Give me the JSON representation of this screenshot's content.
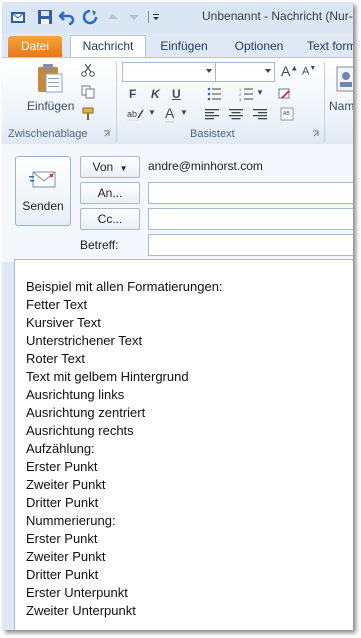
{
  "window": {
    "title": "Unbenannt - Nachricht (Nur-Text)"
  },
  "tabs": [
    {
      "label": "Datei"
    },
    {
      "label": "Nachricht"
    },
    {
      "label": "Einfügen"
    },
    {
      "label": "Optionen"
    },
    {
      "label": "Text formatieren"
    }
  ],
  "ribbon": {
    "paste_label": "Einfügen",
    "group_clipboard": "Zwischenablage",
    "group_basictext": "Basistext",
    "names_label": "Namen",
    "bold": "F",
    "italic": "K",
    "underline": "U"
  },
  "header": {
    "send_label": "Senden",
    "from_label": "Von",
    "from_value": "andre@minhorst.com",
    "to_label": "An...",
    "cc_label": "Cc...",
    "subject_label": "Betreff:"
  },
  "body": {
    "lines": [
      "Beispiel mit allen Formatierungen:",
      "Fetter Text",
      "Kursiver Text",
      "Unterstrichener Text",
      "Roter Text",
      "Text mit gelbem Hintergrund",
      "Ausrichtung links",
      "Ausrichtung zentriert",
      "Ausrichtung rechts",
      "Aufzählung:",
      "Erster Punkt",
      "Zweiter Punkt",
      "Dritter Punkt",
      "Nummerierung:",
      "Erster Punkt",
      "Zweiter Punkt",
      "Dritter Punkt",
      "Erster Unterpunkt",
      "Zweiter Unterpunkt"
    ]
  },
  "colors": {
    "file_tab": "#e4791c",
    "ribbon_text": "#1e395b",
    "accent_blue": "#2a6bc6"
  }
}
